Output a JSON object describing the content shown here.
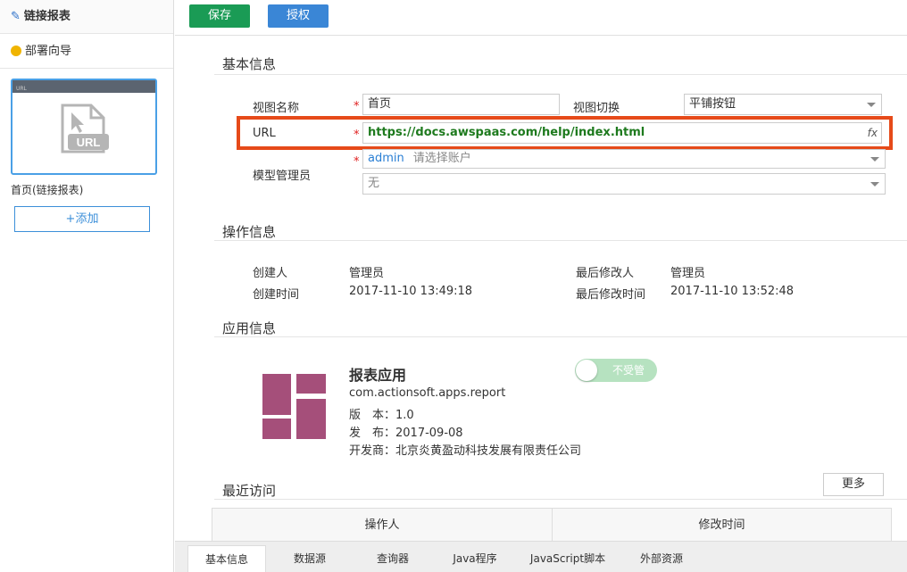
{
  "sidebar": {
    "title": "链接报表",
    "wizard": "部署向导",
    "thumb_label": "首页(链接报表)",
    "thumb_bar": "URL",
    "thumb_icon_text": "URL",
    "add_label": "添加"
  },
  "toolbar": {
    "save_label": "保存",
    "auth_label": "授权"
  },
  "basic": {
    "title": "基本信息",
    "view_name_label": "视图名称",
    "view_name_value": "首页",
    "view_switch_label": "视图切换",
    "view_switch_value": "平铺按钮",
    "url_label": "URL",
    "url_value": "https://docs.awspaas.com/help/index.html",
    "fx_label": "fx",
    "admin_label": "模型管理员",
    "admin_tag": "admin",
    "admin_placeholder": "请选择账户",
    "admin_second": "无"
  },
  "ops": {
    "title": "操作信息",
    "creator_label": "创建人",
    "creator_value": "管理员",
    "created_label": "创建时间",
    "created_value": "2017-11-10 13:49:18",
    "modifier_label": "最后修改人",
    "modifier_value": "管理员",
    "modified_label": "最后修改时间",
    "modified_value": "2017-11-10 13:52:48"
  },
  "app": {
    "title": "应用信息",
    "name": "报表应用",
    "id": "com.actionsoft.apps.report",
    "version": "版　本：1.0",
    "release": "发　布：2017-09-08",
    "developer": "开发商：北京炎黄盈动科技发展有限责任公司",
    "toggle_label": "不受管",
    "toggle_on": false,
    "logo_color": "#a54f7a"
  },
  "recent": {
    "title": "最近访问",
    "more_label": "更多",
    "columns": [
      "操作人",
      "修改时间"
    ]
  },
  "tabs": [
    "基本信息",
    "数据源",
    "查询器",
    "Java程序",
    "JavaScript脚本",
    "外部资源"
  ],
  "colors": {
    "save": "#1a9b55",
    "auth": "#3a86d6",
    "highlight": "#e64a19",
    "url": "#1e7a1e"
  }
}
